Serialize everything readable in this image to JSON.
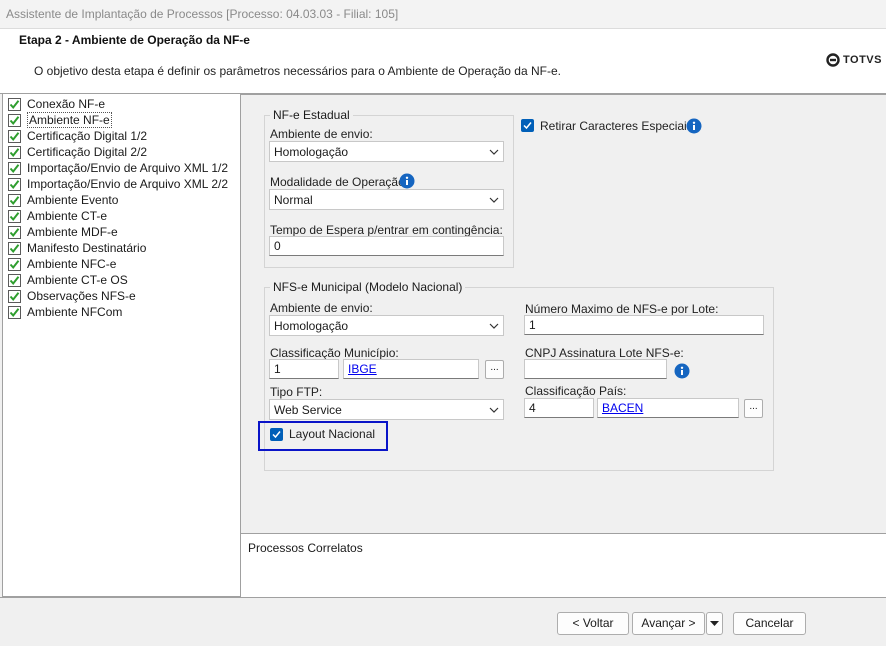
{
  "window": {
    "title": "Assistente de Implantação de Processos [Processo: 04.03.03 - Filial: 105]"
  },
  "header": {
    "step_title": "Etapa 2 - Ambiente de Operação da NF-e",
    "step_description": "O objetivo desta etapa é definir os parâmetros necessários para o Ambiente de Operação da NF-e.",
    "logo_text": "TOTVS"
  },
  "steps": [
    {
      "label": "Conexão NF-e",
      "done": true
    },
    {
      "label": "Ambiente NF-e",
      "done": true,
      "active": true
    },
    {
      "label": "Certificação Digital 1/2",
      "done": true
    },
    {
      "label": "Certificação Digital 2/2",
      "done": true
    },
    {
      "label": "Importação/Envio de Arquivo XML 1/2",
      "done": true
    },
    {
      "label": "Importação/Envio de Arquivo XML 2/2",
      "done": true
    },
    {
      "label": "Ambiente Evento",
      "done": true
    },
    {
      "label": "Ambiente CT-e",
      "done": true
    },
    {
      "label": "Ambiente MDF-e",
      "done": true
    },
    {
      "label": "Manifesto Destinatário",
      "done": true
    },
    {
      "label": "Ambiente NFC-e",
      "done": true
    },
    {
      "label": "Ambiente CT-e OS",
      "done": true
    },
    {
      "label": "Observações NFS-e",
      "done": true
    },
    {
      "label": "Ambiente NFCom",
      "done": true
    }
  ],
  "nfe_estadual": {
    "legend": "NF-e Estadual",
    "ambiente_label": "Ambiente de envio:",
    "ambiente_value": "Homologação",
    "modalidade_label": "Modalidade de Operação:",
    "modalidade_value": "Normal",
    "tempo_label": "Tempo de Espera p/entrar em contingência:",
    "tempo_value": "0"
  },
  "retirar_caracteres": {
    "label": "Retirar Caracteres Especiais",
    "checked": true
  },
  "nfse_municipal": {
    "legend": "NFS-e Municipal (Modelo Nacional)",
    "ambiente_label": "Ambiente de envio:",
    "ambiente_value": "Homologação",
    "numero_max_label": "Número Maximo de NFS-e por Lote:",
    "numero_max_value": "1",
    "classif_municipio_label": "Classificação Município:",
    "classif_municipio_value": "1",
    "classif_municipio_link": "IBGE",
    "cnpj_label": "CNPJ Assinatura Lote NFS-e:",
    "cnpj_value": "",
    "tipo_ftp_label": "Tipo FTP:",
    "tipo_ftp_value": "Web Service",
    "classif_pais_label": "Classificação País:",
    "classif_pais_value": "4",
    "classif_pais_link": "BACEN",
    "layout_nacional_label": "Layout Nacional",
    "layout_nacional_checked": true,
    "browse_label": "..."
  },
  "correlatos": {
    "label": "Processos Correlatos"
  },
  "footer": {
    "back_label": "< Voltar",
    "next_label": "Avançar >",
    "cancel_label": "Cancelar"
  },
  "colors": {
    "accent": "#005fb8",
    "highlight": "#0a14c8",
    "check_green": "#2e9e2e"
  }
}
